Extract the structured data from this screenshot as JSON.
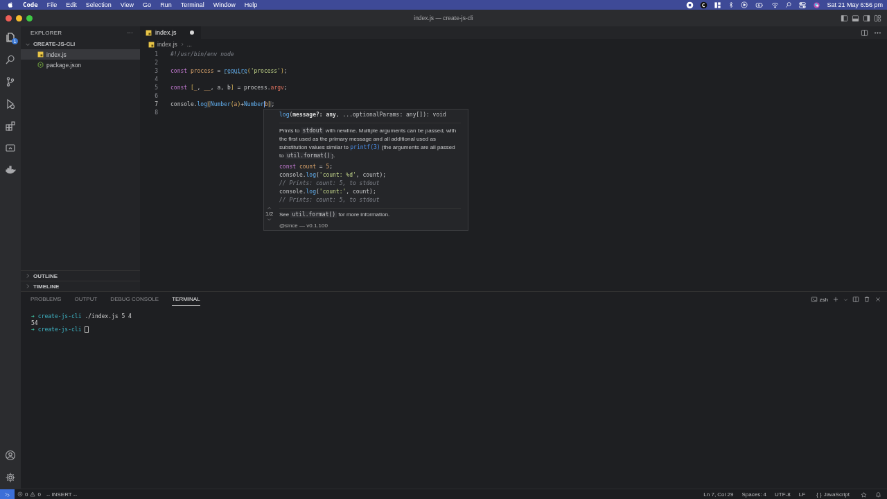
{
  "menu_bar": {
    "app": "Code",
    "items": [
      "File",
      "Edit",
      "Selection",
      "View",
      "Go",
      "Run",
      "Terminal",
      "Window",
      "Help"
    ],
    "clock": "Sat 21 May  6:56 pm"
  },
  "window": {
    "title": "index.js — create-js-cli"
  },
  "activity_bar": {
    "explorer_badge": "1"
  },
  "sidebar": {
    "title": "EXPLORER",
    "more": "···",
    "folder": {
      "label": "CREATE-JS-CLI",
      "expanded": true,
      "children": [
        {
          "label": "index.js",
          "kind": "js",
          "selected": true
        },
        {
          "label": "package.json",
          "kind": "npm",
          "selected": false
        }
      ]
    },
    "sections": [
      {
        "label": "OUTLINE",
        "expanded": false
      },
      {
        "label": "TIMELINE",
        "expanded": false
      }
    ]
  },
  "editor": {
    "tabs": [
      {
        "label": "index.js",
        "kind": "js",
        "selected": true,
        "modified": true
      }
    ],
    "breadcrumb": [
      "index.js",
      "..."
    ],
    "lines": [
      {
        "number": "1",
        "current": false,
        "tokens": [
          {
            "kind": "comment",
            "text": "#!/usr/bin/env node"
          }
        ]
      },
      {
        "number": "2",
        "current": false
      },
      {
        "number": "3",
        "current": false,
        "tokens": [
          {
            "kind": "keyword",
            "text": "const "
          },
          {
            "kind": "variable",
            "text": "process"
          },
          {
            "kind": "plain",
            "text": " = "
          },
          {
            "kind": "hint",
            "text": "require"
          },
          {
            "kind": "bracket",
            "text": "("
          },
          {
            "kind": "string",
            "text": "'process'"
          },
          {
            "kind": "bracket",
            "text": ")"
          },
          {
            "kind": "plain",
            "text": ";"
          }
        ]
      },
      {
        "number": "4",
        "current": false
      },
      {
        "number": "5",
        "current": false,
        "tokens": [
          {
            "kind": "keyword",
            "text": "const "
          },
          {
            "kind": "bracket",
            "text": "["
          },
          {
            "kind": "variable",
            "text": "_"
          },
          {
            "kind": "plain",
            "text": ", "
          },
          {
            "kind": "variable",
            "text": "__"
          },
          {
            "kind": "plain",
            "text": ", a, b"
          },
          {
            "kind": "bracket",
            "text": "]"
          },
          {
            "kind": "plain",
            "text": " = process."
          },
          {
            "kind": "property",
            "text": "argv"
          },
          {
            "kind": "plain",
            "text": ";"
          }
        ]
      },
      {
        "number": "6",
        "current": false
      },
      {
        "number": "7",
        "current": true,
        "tokens": [
          {
            "kind": "plain",
            "text": "console."
          },
          {
            "kind": "function",
            "text": "log"
          },
          {
            "kind": "match",
            "text": "("
          },
          {
            "kind": "function",
            "text": "Number"
          },
          {
            "kind": "bracket",
            "text": "("
          },
          {
            "kind": "param",
            "text": "a"
          },
          {
            "kind": "bracket",
            "text": ")"
          },
          {
            "kind": "plain",
            "text": "+"
          },
          {
            "kind": "function",
            "text": "Number"
          },
          {
            "kind": "param",
            "text": "b",
            "cursor": true
          },
          {
            "kind": "match",
            "text": ")"
          },
          {
            "kind": "plain",
            "text": ";"
          }
        ]
      },
      {
        "number": "8",
        "current": false
      }
    ],
    "hover": {
      "signature": [
        {
          "kind": "function",
          "text": "log"
        },
        {
          "kind": "plain",
          "text": "("
        },
        {
          "kind": "bold",
          "text": "message?: any"
        },
        {
          "kind": "plain",
          "text": ", ...optionalParams: any[]): void"
        }
      ],
      "description": [
        {
          "kind": "text",
          "text": "Prints to "
        },
        {
          "kind": "code",
          "text": "stdout"
        },
        {
          "kind": "text",
          "text": " with newline. Multiple arguments can be passed, with the first used as the primary message and all additional used as substitution values similar to "
        },
        {
          "kind": "link",
          "text": "printf(3)"
        },
        {
          "kind": "text",
          "text": " (the arguments are all passed to "
        },
        {
          "kind": "code",
          "text": "util.format()"
        },
        {
          "kind": "text",
          "text": ")."
        }
      ],
      "example": [
        [
          {
            "kind": "keyword",
            "text": "const "
          },
          {
            "kind": "variable",
            "text": "count"
          },
          {
            "kind": "plain",
            "text": " = "
          },
          {
            "kind": "number",
            "text": "5"
          },
          {
            "kind": "plain",
            "text": ";"
          }
        ],
        [
          {
            "kind": "plain",
            "text": "console."
          },
          {
            "kind": "function",
            "text": "log"
          },
          {
            "kind": "plain",
            "text": "("
          },
          {
            "kind": "string",
            "text": "'count: %d'"
          },
          {
            "kind": "plain",
            "text": ", count);"
          }
        ],
        [
          {
            "kind": "comment",
            "text": "// Prints: count: 5, to stdout"
          }
        ],
        [
          {
            "kind": "plain",
            "text": "console."
          },
          {
            "kind": "function",
            "text": "log"
          },
          {
            "kind": "plain",
            "text": "("
          },
          {
            "kind": "string",
            "text": "'count:'"
          },
          {
            "kind": "plain",
            "text": ", count);"
          }
        ],
        [
          {
            "kind": "comment",
            "text": "// Prints: count: 5, to stdout"
          }
        ]
      ],
      "see": [
        {
          "kind": "text",
          "text": "See "
        },
        {
          "kind": "code",
          "text": "util.format()"
        },
        {
          "kind": "text",
          "text": " for more information."
        }
      ],
      "since": "@since — v0.1.100",
      "pager": "1/2"
    }
  },
  "panel": {
    "tabs": [
      {
        "label": "PROBLEMS",
        "selected": false
      },
      {
        "label": "OUTPUT",
        "selected": false
      },
      {
        "label": "DEBUG CONSOLE",
        "selected": false
      },
      {
        "label": "TERMINAL",
        "selected": true
      }
    ],
    "shell": "zsh",
    "terminal": [
      [
        {
          "kind": "arrow",
          "text": "➜"
        },
        {
          "kind": "dir",
          "text": "create-js-cli"
        },
        {
          "kind": "plain",
          "text": "./index.js 5 4"
        }
      ],
      [
        {
          "kind": "plain",
          "text": "54"
        }
      ],
      [
        {
          "kind": "arrow",
          "text": "➜"
        },
        {
          "kind": "dir",
          "text": "create-js-cli"
        },
        {
          "kind": "cursor"
        }
      ]
    ]
  },
  "status_bar": {
    "errors": "0",
    "warnings": "0",
    "mode": "-- INSERT --",
    "right": [
      {
        "kind": "text",
        "text": "Ln 7, Col 29"
      },
      {
        "kind": "text",
        "text": "Spaces: 4"
      },
      {
        "kind": "text",
        "text": "UTF-8"
      },
      {
        "kind": "text",
        "text": "LF"
      },
      {
        "kind": "language",
        "icon": "{ }",
        "text": "JavaScript"
      }
    ]
  }
}
